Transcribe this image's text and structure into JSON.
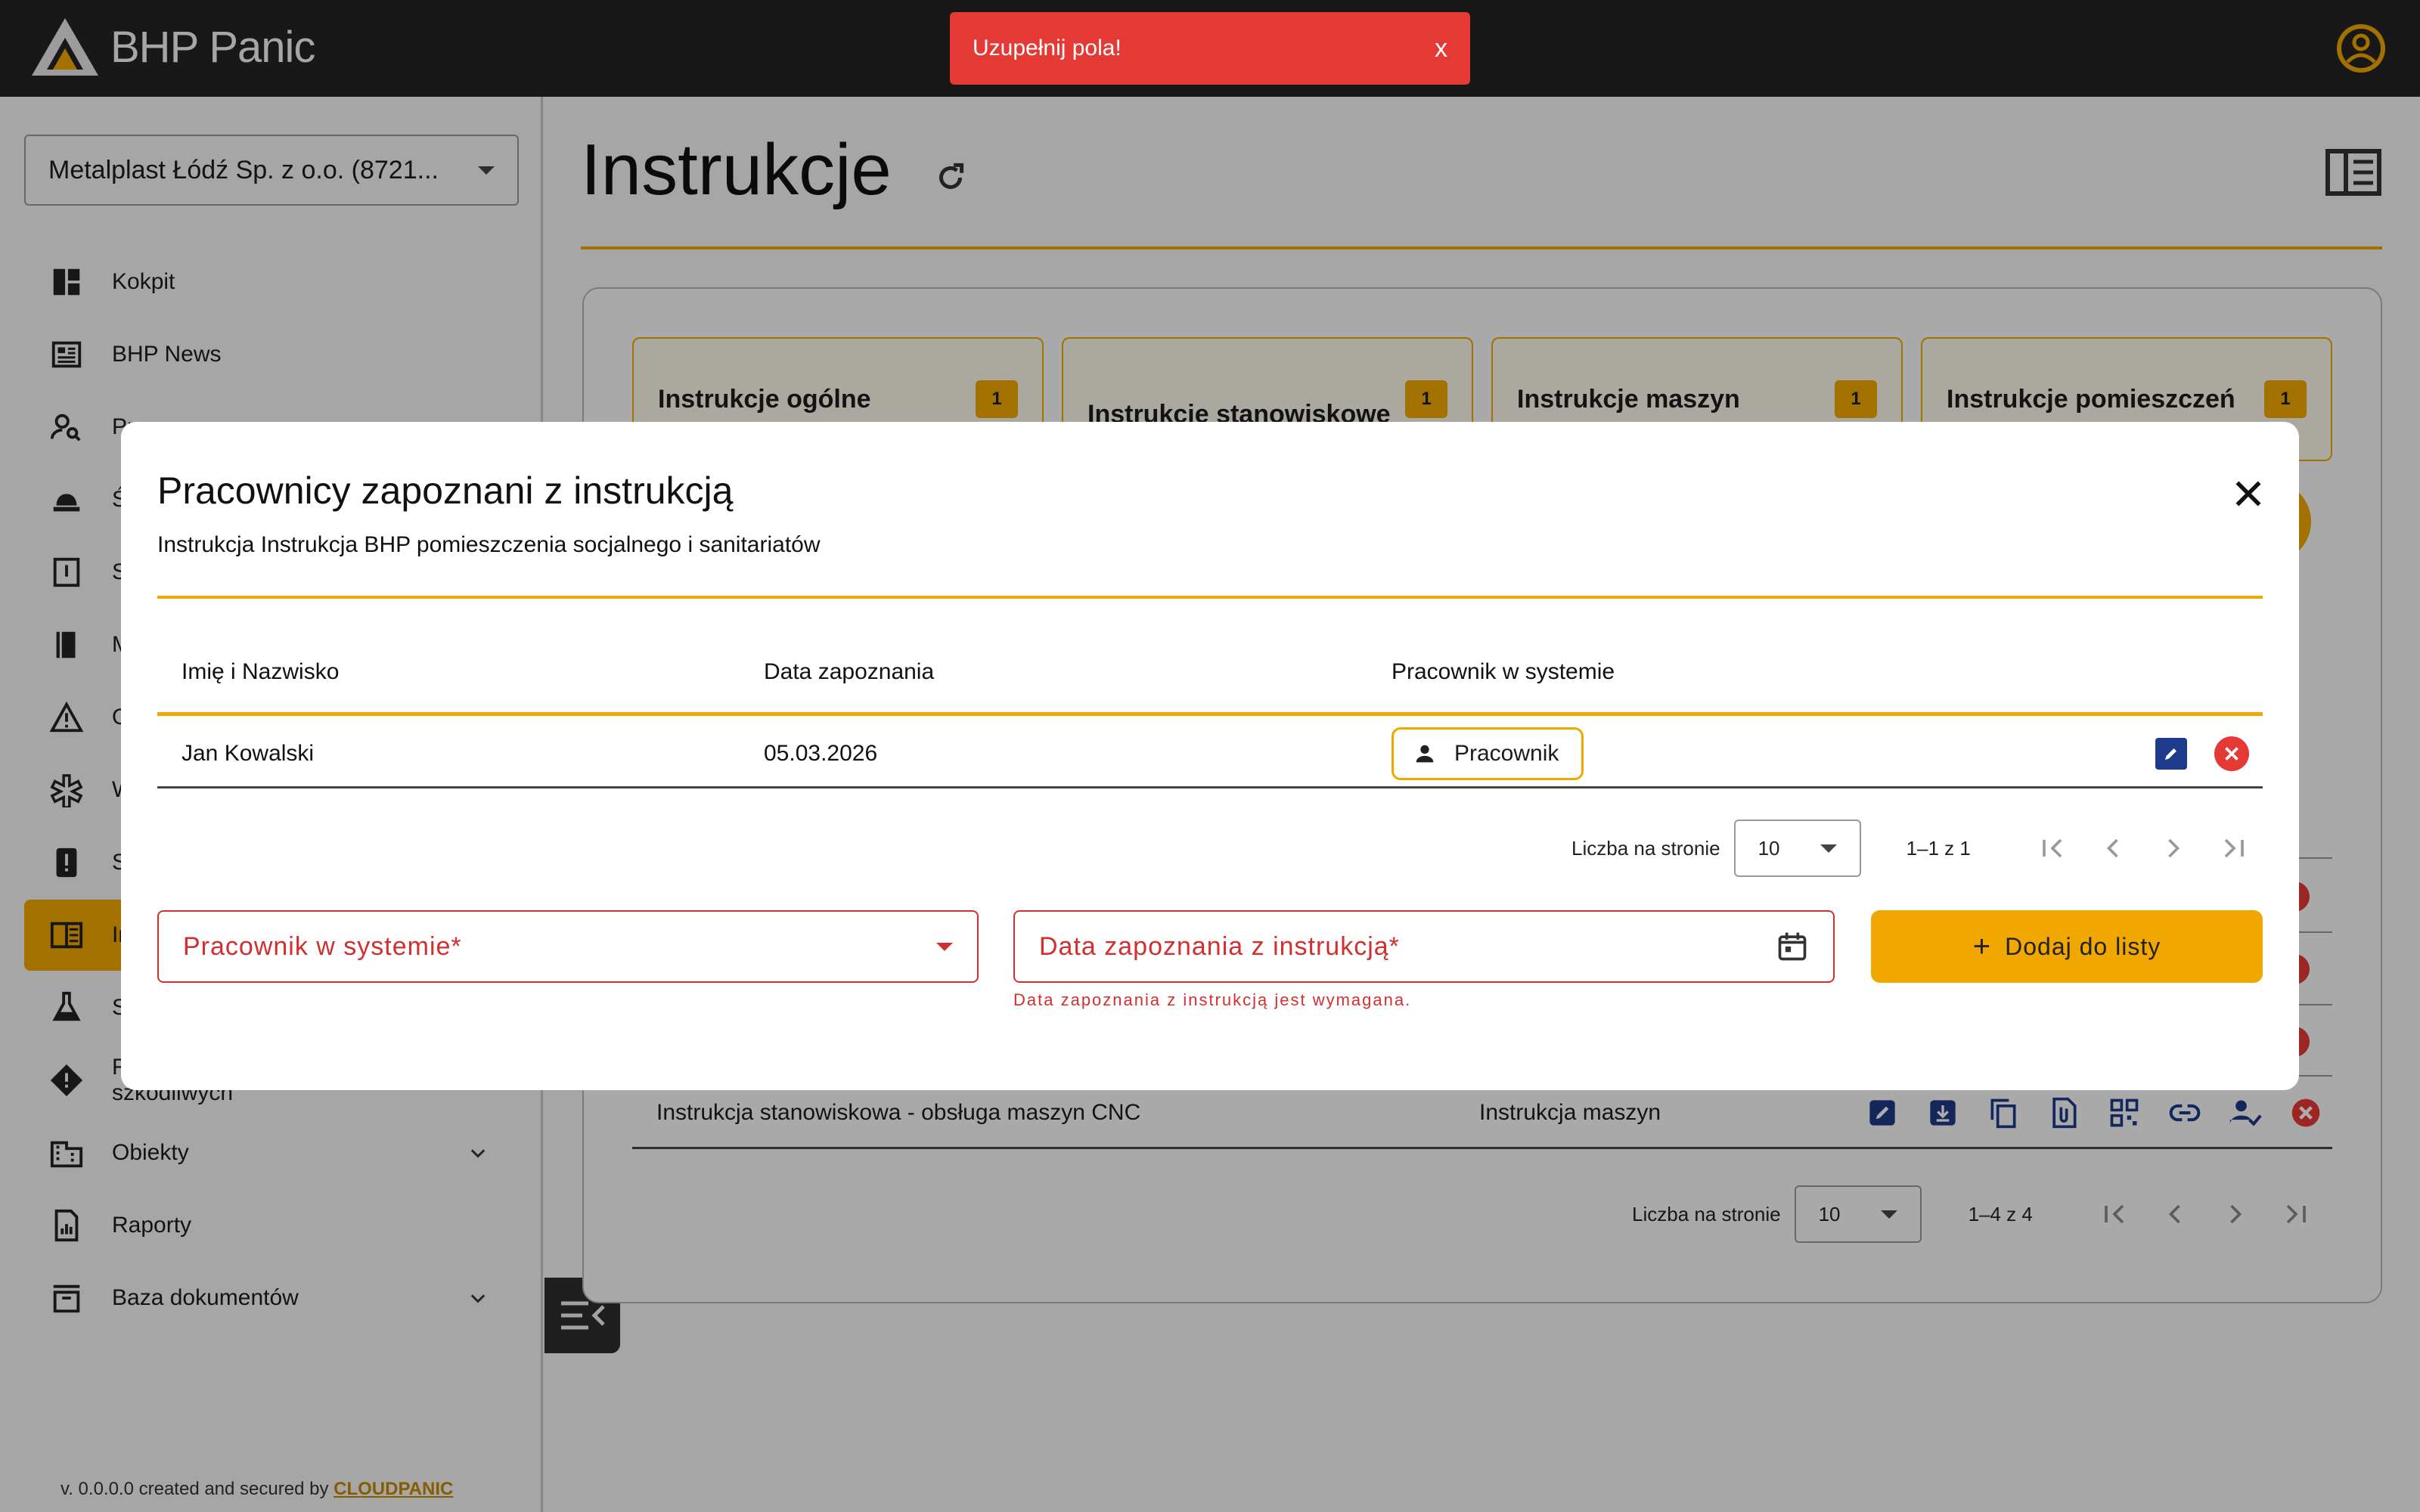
{
  "app": {
    "name": "BHP Panic"
  },
  "sidebar": {
    "company": "Metalplast Łódź Sp. z o.o. (8721...",
    "items": [
      {
        "label": "Kokpit",
        "icon": "dashboard-icon"
      },
      {
        "label": "BHP News",
        "icon": "newspaper-icon"
      },
      {
        "label": "Pr",
        "icon": "person-search-icon"
      },
      {
        "label": "Śr",
        "icon": "hard-hat-icon"
      },
      {
        "label": "Sz",
        "icon": "training-book-icon"
      },
      {
        "label": "M",
        "icon": "book-icon"
      },
      {
        "label": "O",
        "icon": "warning-triangle-icon"
      },
      {
        "label": "W",
        "icon": "medical-icon"
      },
      {
        "label": "Sy",
        "icon": "alert-box-icon"
      },
      {
        "label": "In",
        "icon": "instructions-icon",
        "active": true
      },
      {
        "label": "Su",
        "icon": "flask-icon"
      },
      {
        "label": "Ro",
        "label2": "szkodliwych",
        "icon": "hazard-icon"
      },
      {
        "label": "Obiekty",
        "icon": "building-icon",
        "expandable": true
      },
      {
        "label": "Raporty",
        "icon": "report-icon"
      },
      {
        "label": "Baza dokumentów",
        "icon": "archive-icon",
        "expandable": true
      }
    ],
    "footer_prefix": "v. 0.0.0.0 created and secured by",
    "footer_brand": "CLOUDPANIC"
  },
  "main": {
    "title": "Instrukcje",
    "tabs": [
      {
        "label": "Instrukcje ogólne",
        "count": "1"
      },
      {
        "label": "Instrukcje stanowiskowe",
        "count": "1"
      },
      {
        "label": "Instrukcje maszyn",
        "count": "1"
      },
      {
        "label": "Instrukcje pomieszczeń",
        "count": "1"
      }
    ],
    "visible_row": {
      "name": "Instrukcja stanowiskowa - obsługa maszyn CNC",
      "type": "Instrukcja maszyn"
    },
    "pagination": {
      "label": "Liczba na stronie",
      "page_size": "10",
      "range": "1–4 z 4"
    }
  },
  "snackbar": {
    "message": "Uzupełnij pola!",
    "close": "x"
  },
  "dialog": {
    "title": "Pracownicy zapoznani z instrukcją",
    "subtitle": "Instrukcja Instrukcja BHP pomieszczenia socjalnego i sanitariatów",
    "columns": [
      "Imię i Nazwisko",
      "Data zapoznania",
      "Pracownik w systemie"
    ],
    "rows": [
      {
        "name": "Jan Kowalski",
        "date": "05.03.2026",
        "employee": "Pracownik"
      }
    ],
    "pagination": {
      "label": "Liczba na stronie",
      "page_size": "10",
      "range": "1–1 z 1"
    },
    "form": {
      "employee_placeholder": "Pracownik w systemie*",
      "date_placeholder": "Data zapoznania z instrukcją*",
      "date_error": "Data zapoznania z instrukcją jest wymagana.",
      "add_label": "Dodaj do listy"
    }
  },
  "colors": {
    "accent": "#f0a700",
    "topbar": "#242424",
    "error": "#e53935",
    "edit": "#1e3a8a"
  }
}
